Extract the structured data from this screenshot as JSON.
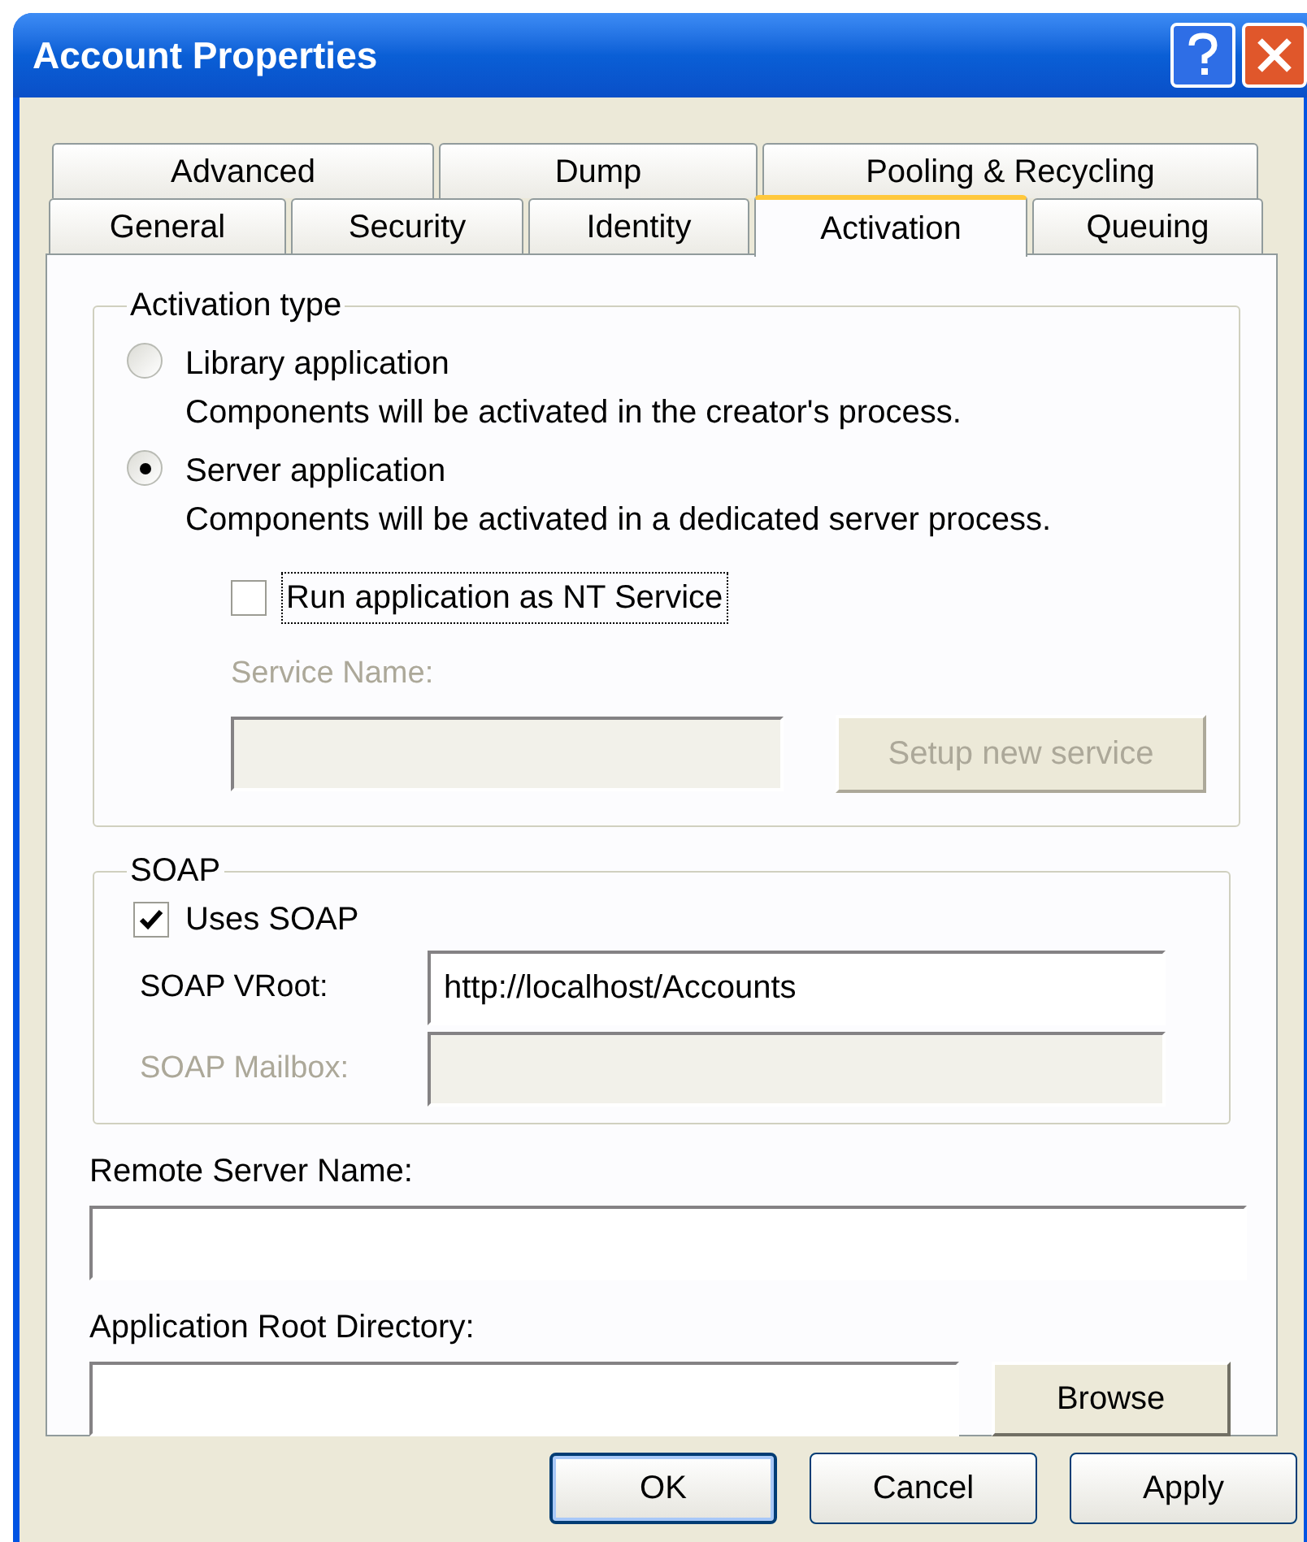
{
  "window": {
    "title": "Account Properties"
  },
  "tab_rows": [
    {
      "tabs": [
        {
          "label": "Advanced",
          "selected": false
        },
        {
          "label": "Dump",
          "selected": false
        },
        {
          "label": "Pooling & Recycling",
          "selected": false
        }
      ]
    },
    {
      "tabs": [
        {
          "label": "General",
          "selected": false
        },
        {
          "label": "Security",
          "selected": false
        },
        {
          "label": "Identity",
          "selected": false
        },
        {
          "label": "Activation",
          "selected": true
        },
        {
          "label": "Queuing",
          "selected": false
        }
      ]
    }
  ],
  "activation_type": {
    "title": "Activation type",
    "options": [
      {
        "label": "Library application",
        "description": "Components will be activated in the creator's process.",
        "selected": false
      },
      {
        "label": "Server application",
        "description": "Components will be activated in a dedicated server process.",
        "selected": true
      }
    ],
    "nt_service": {
      "label": "Run application as NT Service",
      "checked": false,
      "focused": true
    },
    "service_name": {
      "label": "Service Name:",
      "disabled": true
    },
    "setup_button": {
      "label": "Setup new service",
      "disabled": true
    }
  },
  "soap": {
    "title": "SOAP",
    "uses_soap": {
      "label": "Uses SOAP",
      "checked": true
    },
    "vroot": {
      "label": "SOAP VRoot:",
      "value": "http://localhost/Accounts",
      "disabled": false
    },
    "mailbox": {
      "label": "SOAP Mailbox:",
      "disabled": true
    }
  },
  "remote_server": {
    "label": "Remote Server Name:"
  },
  "root_directory": {
    "label": "Application Root Directory:"
  },
  "browse_button": {
    "label": "Browse"
  },
  "buttons": [
    {
      "label": "OK",
      "default": true
    },
    {
      "label": "Cancel",
      "default": false
    },
    {
      "label": "Apply",
      "default": false
    }
  ]
}
